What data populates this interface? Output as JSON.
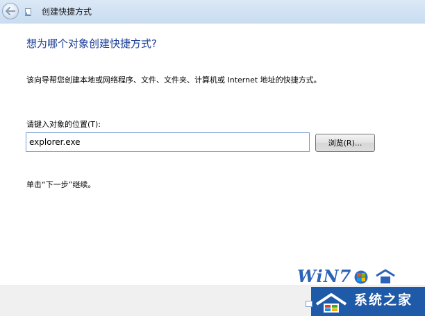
{
  "window": {
    "title": "创建快捷方式"
  },
  "page": {
    "heading": "想为哪个对象创建快捷方式?",
    "description": "该向导帮您创建本地或网络程序、文件、文件夹、计算机或 Internet 地址的快捷方式。",
    "location_label": "请键入对象的位置(T):",
    "location_value": "explorer.exe",
    "browse_label": "浏览(R)...",
    "hint": "单击“下一步”继续。"
  },
  "watermark": {
    "brand": "Win7",
    "site": "系统之家"
  },
  "icons": {
    "back": "back-arrow-icon",
    "app": "shortcut-icon"
  }
}
